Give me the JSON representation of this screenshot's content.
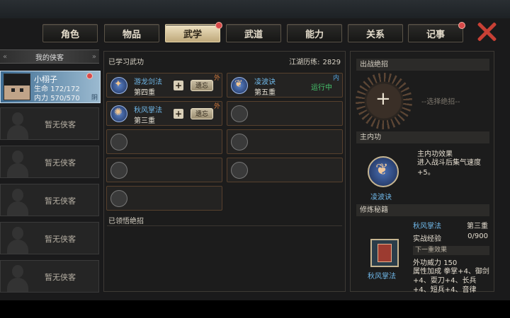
{
  "tabs": [
    {
      "label": "角色",
      "active": false,
      "dot": false
    },
    {
      "label": "物品",
      "active": false,
      "dot": false
    },
    {
      "label": "武学",
      "active": true,
      "dot": true
    },
    {
      "label": "武道",
      "active": false,
      "dot": false
    },
    {
      "label": "能力",
      "active": false,
      "dot": false
    },
    {
      "label": "关系",
      "active": false,
      "dot": false
    },
    {
      "label": "记事",
      "active": false,
      "dot": true
    }
  ],
  "roster": {
    "header": "我的侠客",
    "hero": {
      "name": "小栩子",
      "hp_label": "生命",
      "hp": "172/172",
      "mp_label": "内力",
      "mp": "570/570",
      "alignment": "阴"
    },
    "empty_slots": [
      "暂无侠客",
      "暂无侠客",
      "暂无侠客",
      "暂无侠客",
      "暂无侠客"
    ]
  },
  "learned": {
    "title": "已学习武功",
    "reputation_label": "江湖历练:",
    "reputation_value": "2829",
    "skills": [
      {
        "name": "游龙剑法",
        "level": "第四重",
        "plus": "+",
        "forget": "遗忘",
        "tag": "外"
      },
      {
        "name": "凌波诀",
        "level": "第五重",
        "status": "运行中",
        "tag": "内"
      },
      {
        "name": "秋风掌法",
        "level": "第三重",
        "plus": "+",
        "forget": "遗忘",
        "tag": "外"
      }
    ],
    "comprehended_title": "已领悟绝招"
  },
  "right": {
    "ultimate_title": "出战绝招",
    "ultimate_plus": "+",
    "ultimate_placeholder": "--选择绝招--",
    "inner_title": "主内功",
    "inner_effect_label": "主内功效果",
    "inner_effect_desc": "进入战斗后集气速度+5。",
    "inner_name": "凌波诀",
    "train_title": "修炼秘籍",
    "book_name": "秋风掌法",
    "book_level": "第三重",
    "exp_label": "实战经验",
    "exp_value": "0/900",
    "next_label": "下一重效果",
    "power_label": "外功威力",
    "power_value": "150",
    "attr_label": "属性加成",
    "attr_text": "拳掌+4、御剑+4、耍刀+4、长兵+4、短兵+4、音律"
  }
}
